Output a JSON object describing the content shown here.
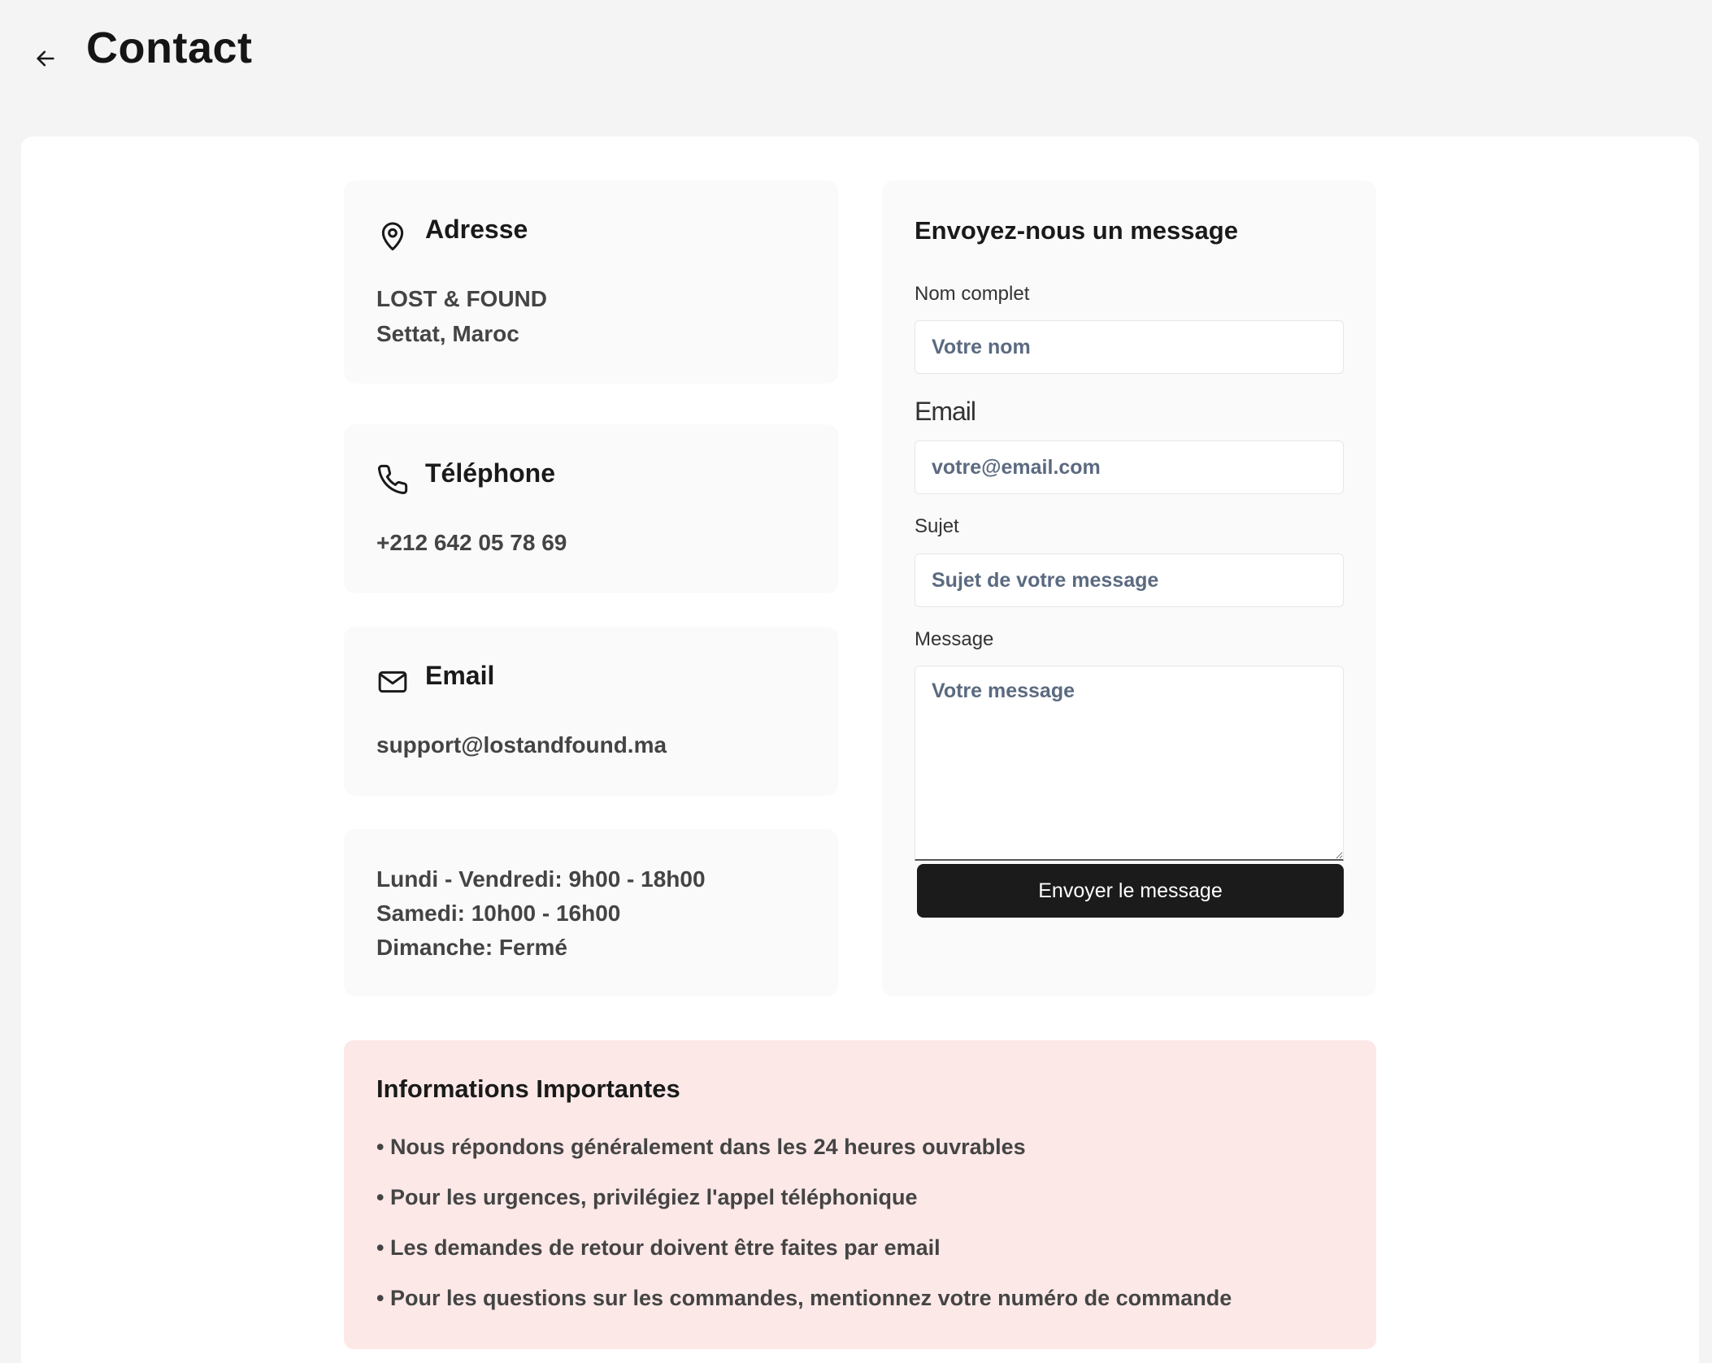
{
  "header": {
    "title": "Contact"
  },
  "address": {
    "title": "Adresse",
    "line1": "LOST & FOUND",
    "line2": "Settat, Maroc"
  },
  "phone": {
    "title": "Téléphone",
    "number": "+212 642 05 78 69"
  },
  "email": {
    "title": "Email",
    "address": "support@lostandfound.ma"
  },
  "hours": {
    "weekdays": "Lundi - Vendredi: 9h00 - 18h00",
    "saturday": "Samedi: 10h00 - 16h00",
    "sunday": "Dimanche: Fermé"
  },
  "form": {
    "title": "Envoyez-nous un message",
    "name_label": "Nom complet",
    "name_placeholder": "Votre nom",
    "email_label": "Email",
    "email_placeholder": "votre@email.com",
    "subject_label": "Sujet",
    "subject_placeholder": "Sujet de votre message",
    "message_label": "Message",
    "message_placeholder": "Votre message",
    "submit_label": "Envoyer le message"
  },
  "notice": {
    "title": "Informations Importantes",
    "items": [
      "• Nous répondons généralement dans les 24 heures ouvrables",
      "• Pour les urgences, privilégiez l'appel téléphonique",
      "• Les demandes de retour doivent être faites par email",
      "• Pour les questions sur les commandes, mentionnez votre numéro de commande"
    ]
  }
}
